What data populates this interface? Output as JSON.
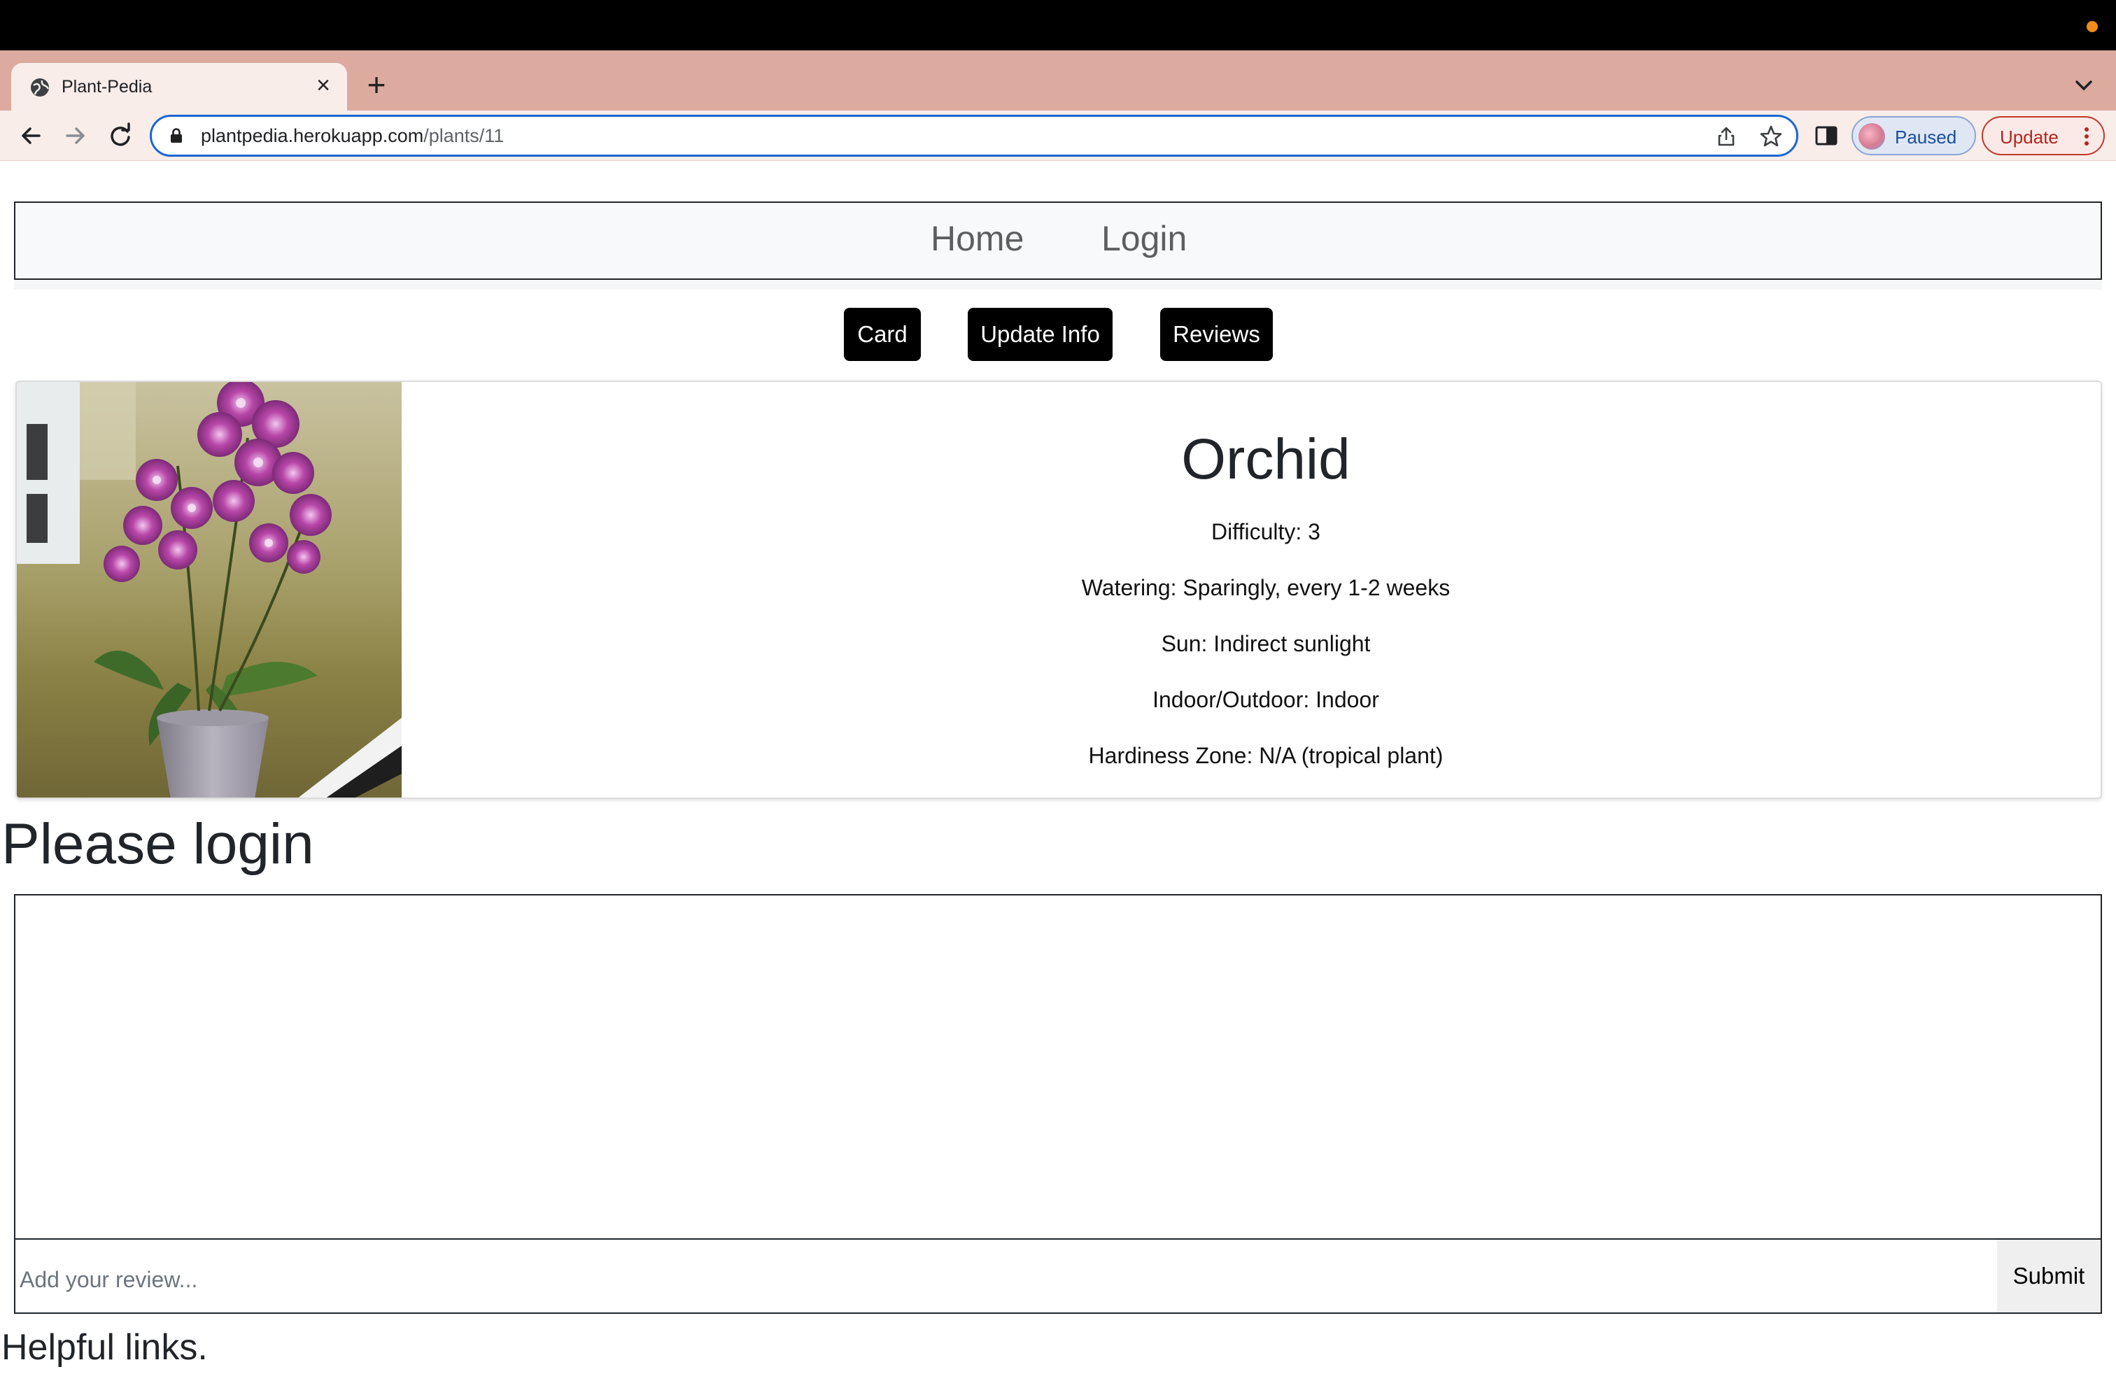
{
  "browser": {
    "tab_title": "Plant-Pedia",
    "url_host": "plantpedia.herokuapp.com",
    "url_path": "/plants/11",
    "profile_label": "Paused",
    "update_label": "Update"
  },
  "nav": {
    "home": "Home",
    "login": "Login"
  },
  "actions": {
    "card": "Card",
    "update_info": "Update Info",
    "reviews": "Reviews"
  },
  "plant": {
    "name": "Orchid",
    "difficulty": "Difficulty: 3",
    "watering": "Watering: Sparingly, every 1-2 weeks",
    "sun": "Sun: Indirect sunlight",
    "location": "Indoor/Outdoor: Indoor",
    "hardiness": "Hardiness Zone: N/A (tropical plant)"
  },
  "reviews": {
    "login_prompt": "Please login",
    "input_placeholder": "Add your review...",
    "input_value": "",
    "submit_label": "Submit"
  },
  "footer": {
    "helpful_links": "Helpful links."
  },
  "colors": {
    "tab_strip": "#dcaa9e",
    "toolbar": "#f8ede9",
    "omnibox_focus": "#1a66d1",
    "button_dark": "#000000",
    "update_red": "#b3261e"
  }
}
